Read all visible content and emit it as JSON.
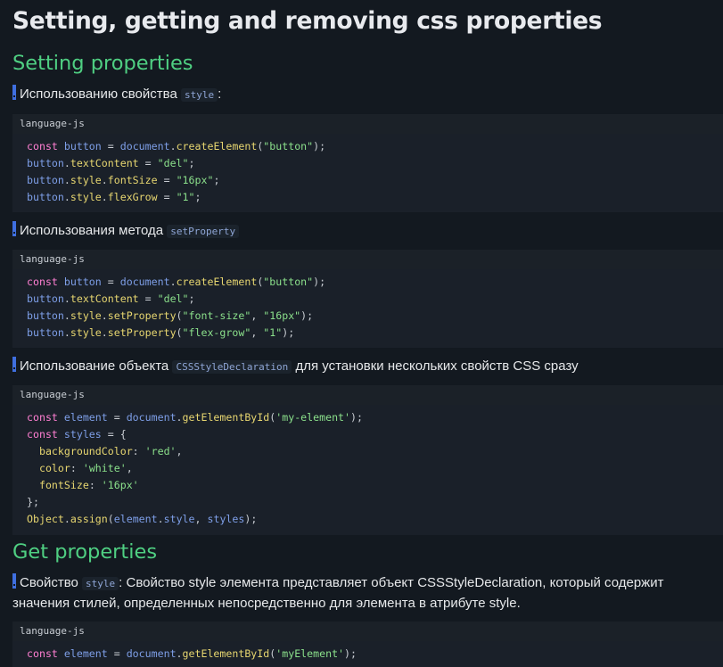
{
  "title": "Setting, getting and removing css properties",
  "sections": {
    "setting": "Setting properties",
    "get": "Get properties"
  },
  "notes": {
    "n1_text": "Использованию свойства",
    "n1_code": "style",
    "n1_tail": ":",
    "n2_text": "Использования метода",
    "n2_code": "setProperty",
    "n3_text": "Использование объекта",
    "n3_code": "CSSStyleDeclaration",
    "n3_tail": "для установки нескольких свойств CSS сразу",
    "n4_text": "Свойство",
    "n4_code": "style",
    "n4_tail": ": Свойство style элемента представляет объект CSSStyleDeclaration, который содержит значения стилей, определенных непосредственно для элемента в атрибуте style."
  },
  "code_lang": "language-js",
  "code1": [
    "const button = document.createElement(\"button\");",
    "button.textContent = \"del\";",
    "button.style.fontSize = \"16px\";",
    "button.style.flexGrow = \"1\";"
  ],
  "code2": [
    "const button = document.createElement(\"button\");",
    "button.textContent = \"del\";",
    "button.style.setProperty(\"font-size\", \"16px\");",
    "button.style.setProperty(\"flex-grow\", \"1\");"
  ],
  "code3": [
    "const element = document.getElementById('my-element');",
    "const styles = {",
    "  backgroundColor: 'red',",
    "  color: 'white',",
    "  fontSize: '16px'",
    "};",
    "Object.assign(element.style, styles);"
  ],
  "code4": [
    "const element = document.getElementById('myElement');"
  ],
  "colors": {
    "background": "#131920",
    "heading_green": "#4fcf82",
    "keyword": "#ff7fd2",
    "variable": "#7e9fe8",
    "function": "#e7d670",
    "string": "#8be08b",
    "note_marker": "#3f6fe0"
  }
}
